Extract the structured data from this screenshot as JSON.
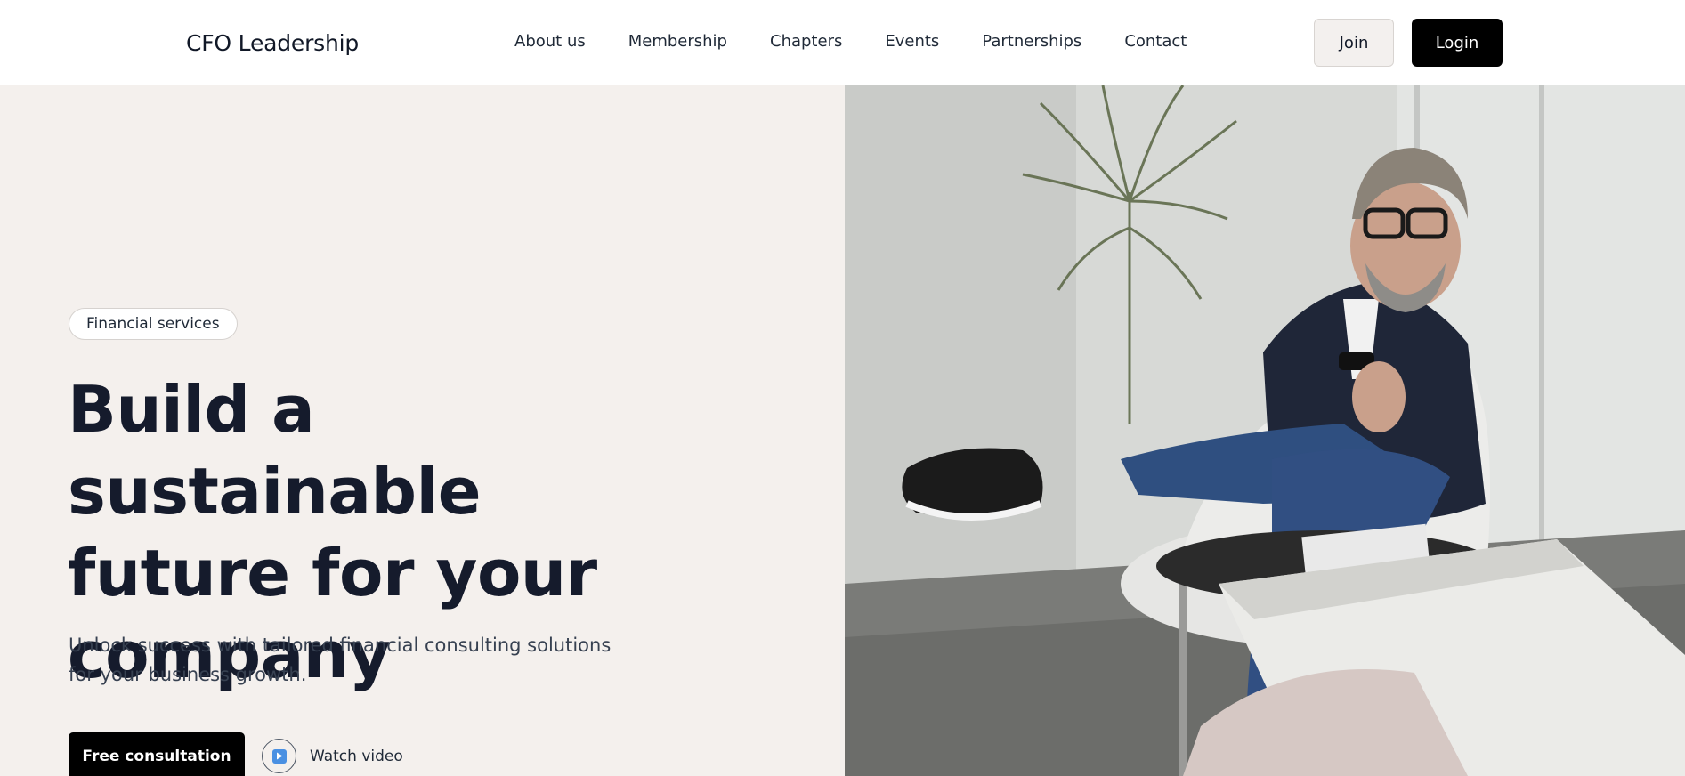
{
  "header": {
    "logo": "CFO Leadership",
    "nav": [
      "About us",
      "Membership",
      "Chapters",
      "Events",
      "Partnerships",
      "Contact"
    ],
    "join_label": "Join",
    "login_label": "Login"
  },
  "hero": {
    "badge": "Financial services",
    "headline_lines": [
      "Build a sustainable",
      "future for your",
      "company"
    ],
    "subtext": "Unlock success with tailored financial consulting solutions for your business growth.",
    "cta_label": "Free consultation",
    "video_label": "Watch video",
    "video_icon": "play-icon",
    "image_subject": "man-seated-in-chair"
  },
  "colors": {
    "accent": "#000000",
    "hero_bg": "#f4f0ed",
    "text_dark": "#151b2c",
    "play_icon": "#4a90e2"
  }
}
